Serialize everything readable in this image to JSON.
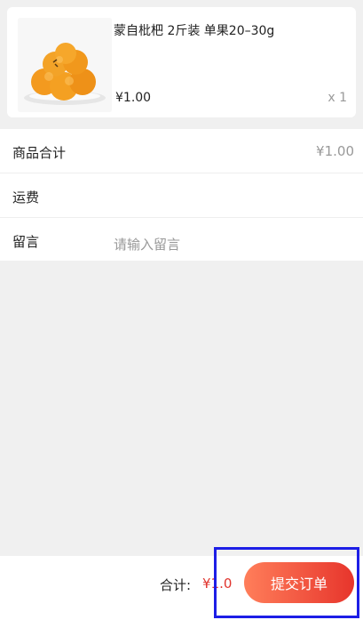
{
  "product": {
    "title": "蒙自枇杷 2斤装 单果20–30g",
    "price": "¥1.00",
    "quantity": "x 1",
    "image_icon": "loquat-fruit-image"
  },
  "summary": {
    "goods_total_label": "商品合计",
    "goods_total_value": "¥1.00",
    "shipping_label": "运费",
    "message_label": "留言",
    "message_placeholder": "请输入留言"
  },
  "footer": {
    "total_label": "合计:",
    "total_amount": "¥1.0",
    "submit_label": "提交订单"
  },
  "colors": {
    "accent": "#e0342d",
    "button_gradient_start": "#ff7e5a",
    "button_gradient_end": "#e7352c",
    "highlight": "#1d1ee6"
  }
}
